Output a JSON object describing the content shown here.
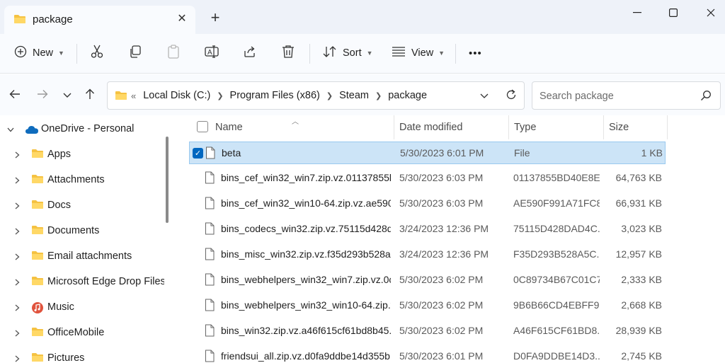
{
  "tab": {
    "title": "package",
    "close": "✕",
    "add": "+"
  },
  "window": {
    "minimize": "—",
    "maximize": "☐",
    "close": "✕"
  },
  "commandbar": {
    "new_label": "New",
    "sort_label": "Sort",
    "view_label": "View",
    "more_label": "•••"
  },
  "address": {
    "overflow": "«",
    "crumbs": [
      "Local Disk (C:)",
      "Program Files (x86)",
      "Steam",
      "package"
    ],
    "search_placeholder": "Search package"
  },
  "sidebar": {
    "root": {
      "label": "OneDrive - Personal",
      "icon": "cloud-icon"
    },
    "items": [
      {
        "label": "Apps",
        "icon": "folder-icon"
      },
      {
        "label": "Attachments",
        "icon": "folder-icon"
      },
      {
        "label": "Docs",
        "icon": "folder-icon"
      },
      {
        "label": "Documents",
        "icon": "folder-icon"
      },
      {
        "label": "Email attachments",
        "icon": "folder-icon"
      },
      {
        "label": "Microsoft Edge Drop Files",
        "icon": "folder-icon"
      },
      {
        "label": "Music",
        "icon": "music-icon"
      },
      {
        "label": "OfficeMobile",
        "icon": "folder-icon"
      },
      {
        "label": "Pictures",
        "icon": "folder-icon"
      }
    ]
  },
  "columns": {
    "name": "Name",
    "date": "Date modified",
    "type": "Type",
    "size": "Size"
  },
  "files": [
    {
      "name": "beta",
      "date": "5/30/2023 6:01 PM",
      "type": "File",
      "size": "1 KB",
      "selected": true
    },
    {
      "name": "bins_cef_win32_win7.zip.vz.01137855b...",
      "date": "5/30/2023 6:03 PM",
      "type": "01137855BD40E8E...",
      "size": "64,763 KB"
    },
    {
      "name": "bins_cef_win32_win10-64.zip.vz.ae590f...",
      "date": "5/30/2023 6:03 PM",
      "type": "AE590F991A71FC8...",
      "size": "66,931 KB"
    },
    {
      "name": "bins_codecs_win32.zip.vz.75115d428d...",
      "date": "3/24/2023 12:36 PM",
      "type": "75115D428DAD4C...",
      "size": "3,023 KB"
    },
    {
      "name": "bins_misc_win32.zip.vz.f35d293b528a5...",
      "date": "3/24/2023 12:36 PM",
      "type": "F35D293B528A5C...",
      "size": "12,957 KB"
    },
    {
      "name": "bins_webhelpers_win32_win7.zip.vz.0c...",
      "date": "5/30/2023 6:02 PM",
      "type": "0C89734B67C01C7...",
      "size": "2,333 KB"
    },
    {
      "name": "bins_webhelpers_win32_win10-64.zip.v...",
      "date": "5/30/2023 6:02 PM",
      "type": "9B6B66CD4EBFF9...",
      "size": "2,668 KB"
    },
    {
      "name": "bins_win32.zip.vz.a46f615cf61bd8b45...",
      "date": "5/30/2023 6:02 PM",
      "type": "A46F615CF61BD8...",
      "size": "28,939 KB"
    },
    {
      "name": "friendsui_all.zip.vz.d0fa9ddbe14d355b...",
      "date": "5/30/2023 6:01 PM",
      "type": "D0FA9DDBE14D3...",
      "size": "2,745 KB"
    }
  ],
  "colors": {
    "accent": "#0067c0",
    "selection": "#cce4f7",
    "folder": "#f5c242"
  }
}
